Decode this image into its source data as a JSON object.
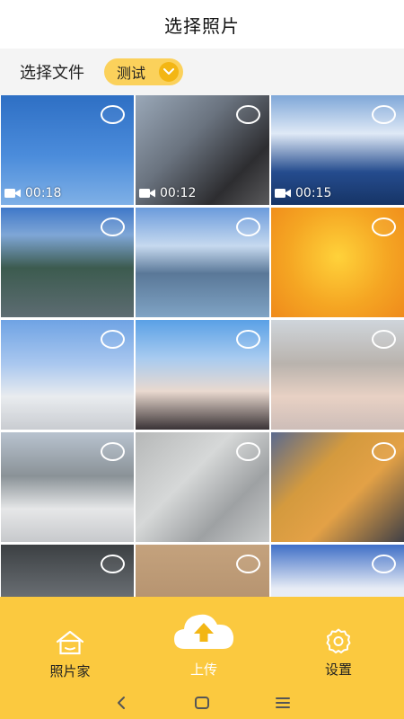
{
  "header": {
    "title": "选择照片"
  },
  "file_bar": {
    "label": "选择文件",
    "album": "测试"
  },
  "grid": {
    "items": [
      {
        "type": "video",
        "duration": "00:18"
      },
      {
        "type": "video",
        "duration": "00:12"
      },
      {
        "type": "video",
        "duration": "00:15"
      },
      {
        "type": "photo"
      },
      {
        "type": "photo"
      },
      {
        "type": "photo"
      },
      {
        "type": "photo"
      },
      {
        "type": "photo"
      },
      {
        "type": "photo"
      },
      {
        "type": "photo"
      },
      {
        "type": "photo"
      },
      {
        "type": "photo"
      },
      {
        "type": "photo"
      },
      {
        "type": "photo"
      },
      {
        "type": "photo"
      }
    ]
  },
  "bottom_nav": {
    "home": "照片家",
    "upload": "上传",
    "settings": "设置"
  },
  "colors": {
    "accent": "#fbc93f",
    "chip": "#fbd15b",
    "chip_icon": "#f3b614"
  },
  "icons": {
    "home": "house-icon",
    "upload": "cloud-upload-icon",
    "settings": "gear-icon",
    "back": "back-chevron-icon",
    "home_sys": "square-home-icon",
    "menu": "menu-lines-icon",
    "video": "video-camera-icon",
    "select": "select-circle-icon"
  }
}
